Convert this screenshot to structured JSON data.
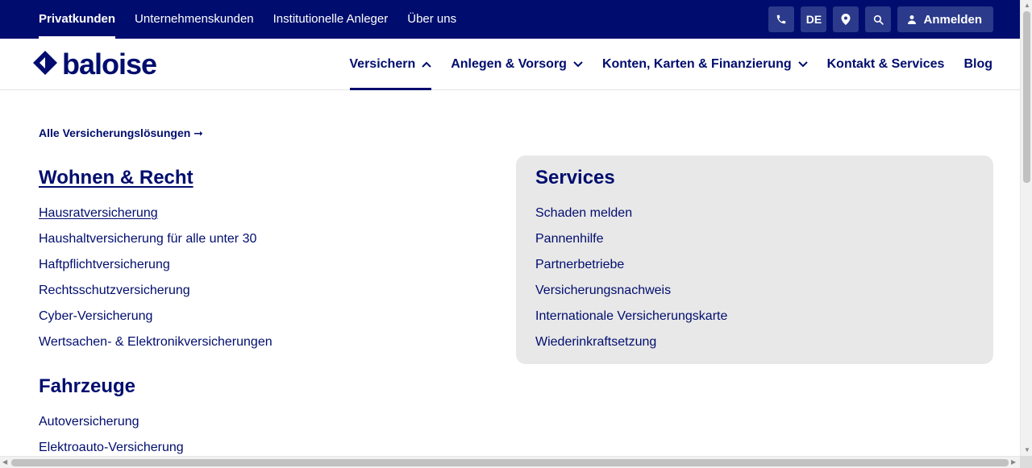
{
  "topbar": {
    "nav": [
      {
        "label": "Privatkunden",
        "active": true
      },
      {
        "label": "Unternehmenskunden",
        "active": false
      },
      {
        "label": "Institutionelle Anleger",
        "active": false
      },
      {
        "label": "Über uns",
        "active": false
      }
    ],
    "language": "DE",
    "login_label": "Anmelden",
    "icons": {
      "phone": "phone-icon",
      "location": "location-pin-icon",
      "search": "search-icon",
      "user": "user-icon"
    }
  },
  "header": {
    "logo_text": "baloise",
    "nav": [
      {
        "label": "Versichern",
        "chevron": "up",
        "active": true
      },
      {
        "label": "Anlegen & Vorsorg",
        "chevron": "down",
        "active": false
      },
      {
        "label": "Konten, Karten & Finanzierung",
        "chevron": "down",
        "active": false
      },
      {
        "label": "Kontakt & Services",
        "chevron": "",
        "active": false
      },
      {
        "label": "Blog",
        "chevron": "",
        "active": false
      }
    ]
  },
  "megamenu": {
    "all_link": "Alle Versicherungslösungen ➞",
    "sections": [
      {
        "title": "Wohnen & Recht",
        "items": [
          "Hausratversicherung",
          "Haushaltversicherung für alle unter 30",
          "Haftpflichtversicherung",
          "Rechtsschutzversicherung",
          "Cyber-Versicherung",
          "Wertsachen- & Elektronikversicherungen"
        ]
      },
      {
        "title": "Fahrzeuge",
        "items": [
          "Autoversicherung",
          "Elektroauto-Versicherung"
        ]
      }
    ],
    "services": {
      "title": "Services",
      "items": [
        "Schaden melden",
        "Pannenhilfe",
        "Partnerbetriebe",
        "Versicherungsnachweis",
        "Internationale Versicherungskarte",
        "Wiederinkraftsetzung"
      ]
    }
  },
  "colors": {
    "brand": "#000d6e",
    "button_bg": "#2b3a8b",
    "services_bg": "#e8e8e8"
  }
}
